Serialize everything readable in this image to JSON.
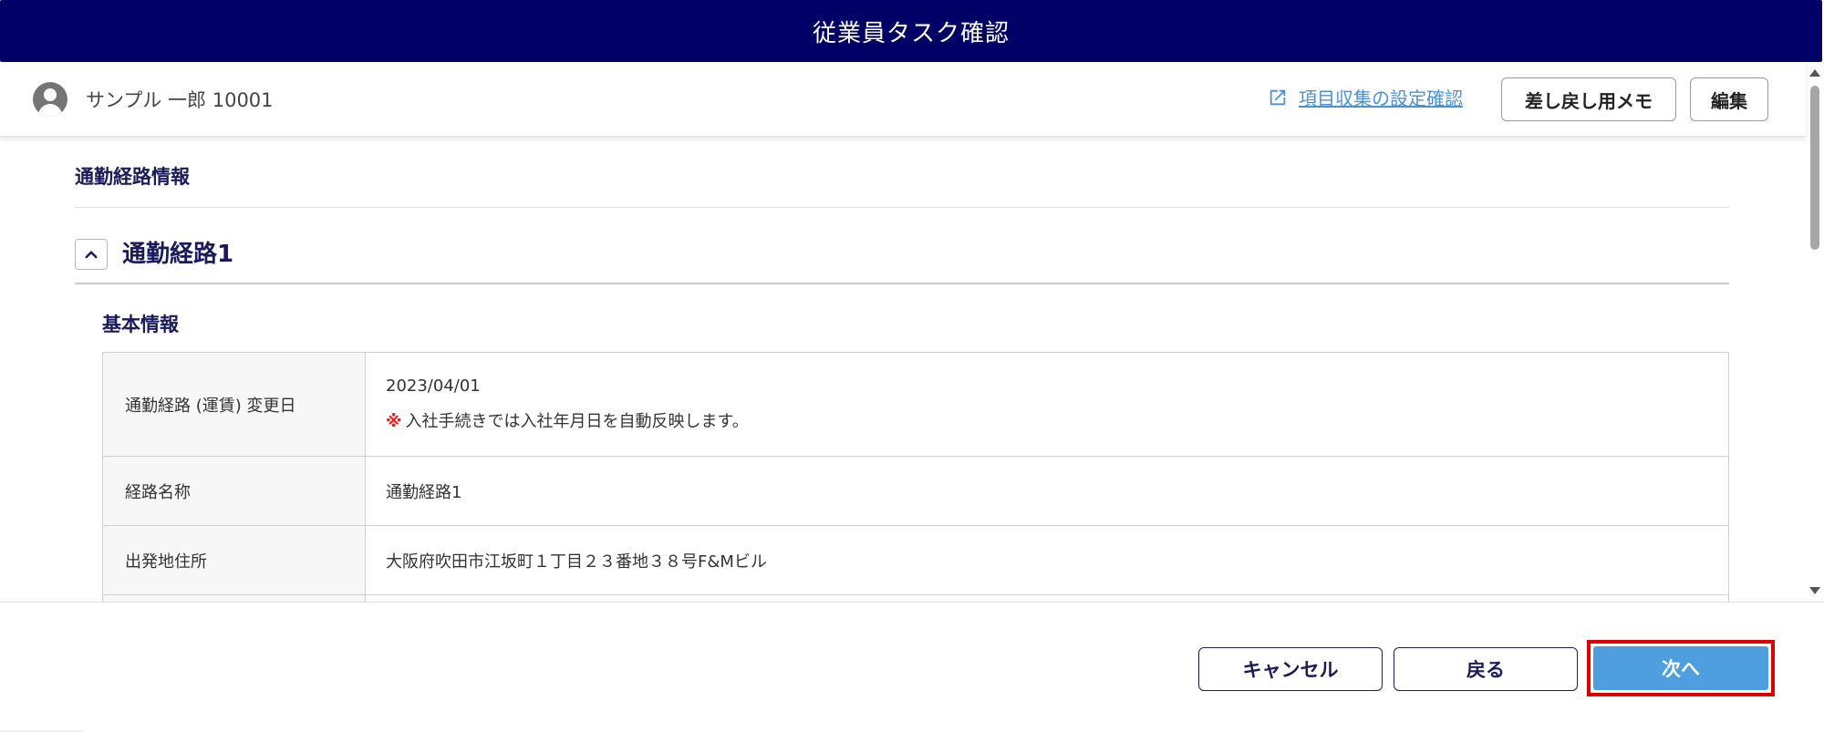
{
  "window": {
    "title": "従業員タスク確認"
  },
  "employee": {
    "name": "サンプル 一郎 10001"
  },
  "header": {
    "settings_link": "項目収集の設定確認",
    "memo_button": "差し戻し用メモ",
    "edit_button": "編集"
  },
  "section": {
    "title": "通勤経路情報",
    "route_title": "通勤経路1",
    "subsection_title": "基本情報"
  },
  "table": {
    "rows": [
      {
        "label": "通勤経路 (運賃) 変更日",
        "value": "2023/04/01",
        "note_mark": "※",
        "note": "入社手続きでは入社年月日を自動反映します。"
      },
      {
        "label": "経路名称",
        "value": "通勤経路1"
      },
      {
        "label": "出発地住所",
        "value": "大阪府吹田市江坂町１丁目２３番地３８号F&Mビル"
      }
    ]
  },
  "footer": {
    "cancel": "キャンセル",
    "back": "戻る",
    "next": "次へ"
  },
  "colors": {
    "title_bar": "#000066",
    "accent_text": "#1a1a5e",
    "link": "#4a90d9",
    "next_button": "#4f9fe0",
    "highlight": "#e00000",
    "note_mark": "#e02020"
  },
  "icons": {
    "avatar": "account-circle-icon",
    "link": "open-in-new-icon",
    "collapse": "chevron-up-icon"
  }
}
